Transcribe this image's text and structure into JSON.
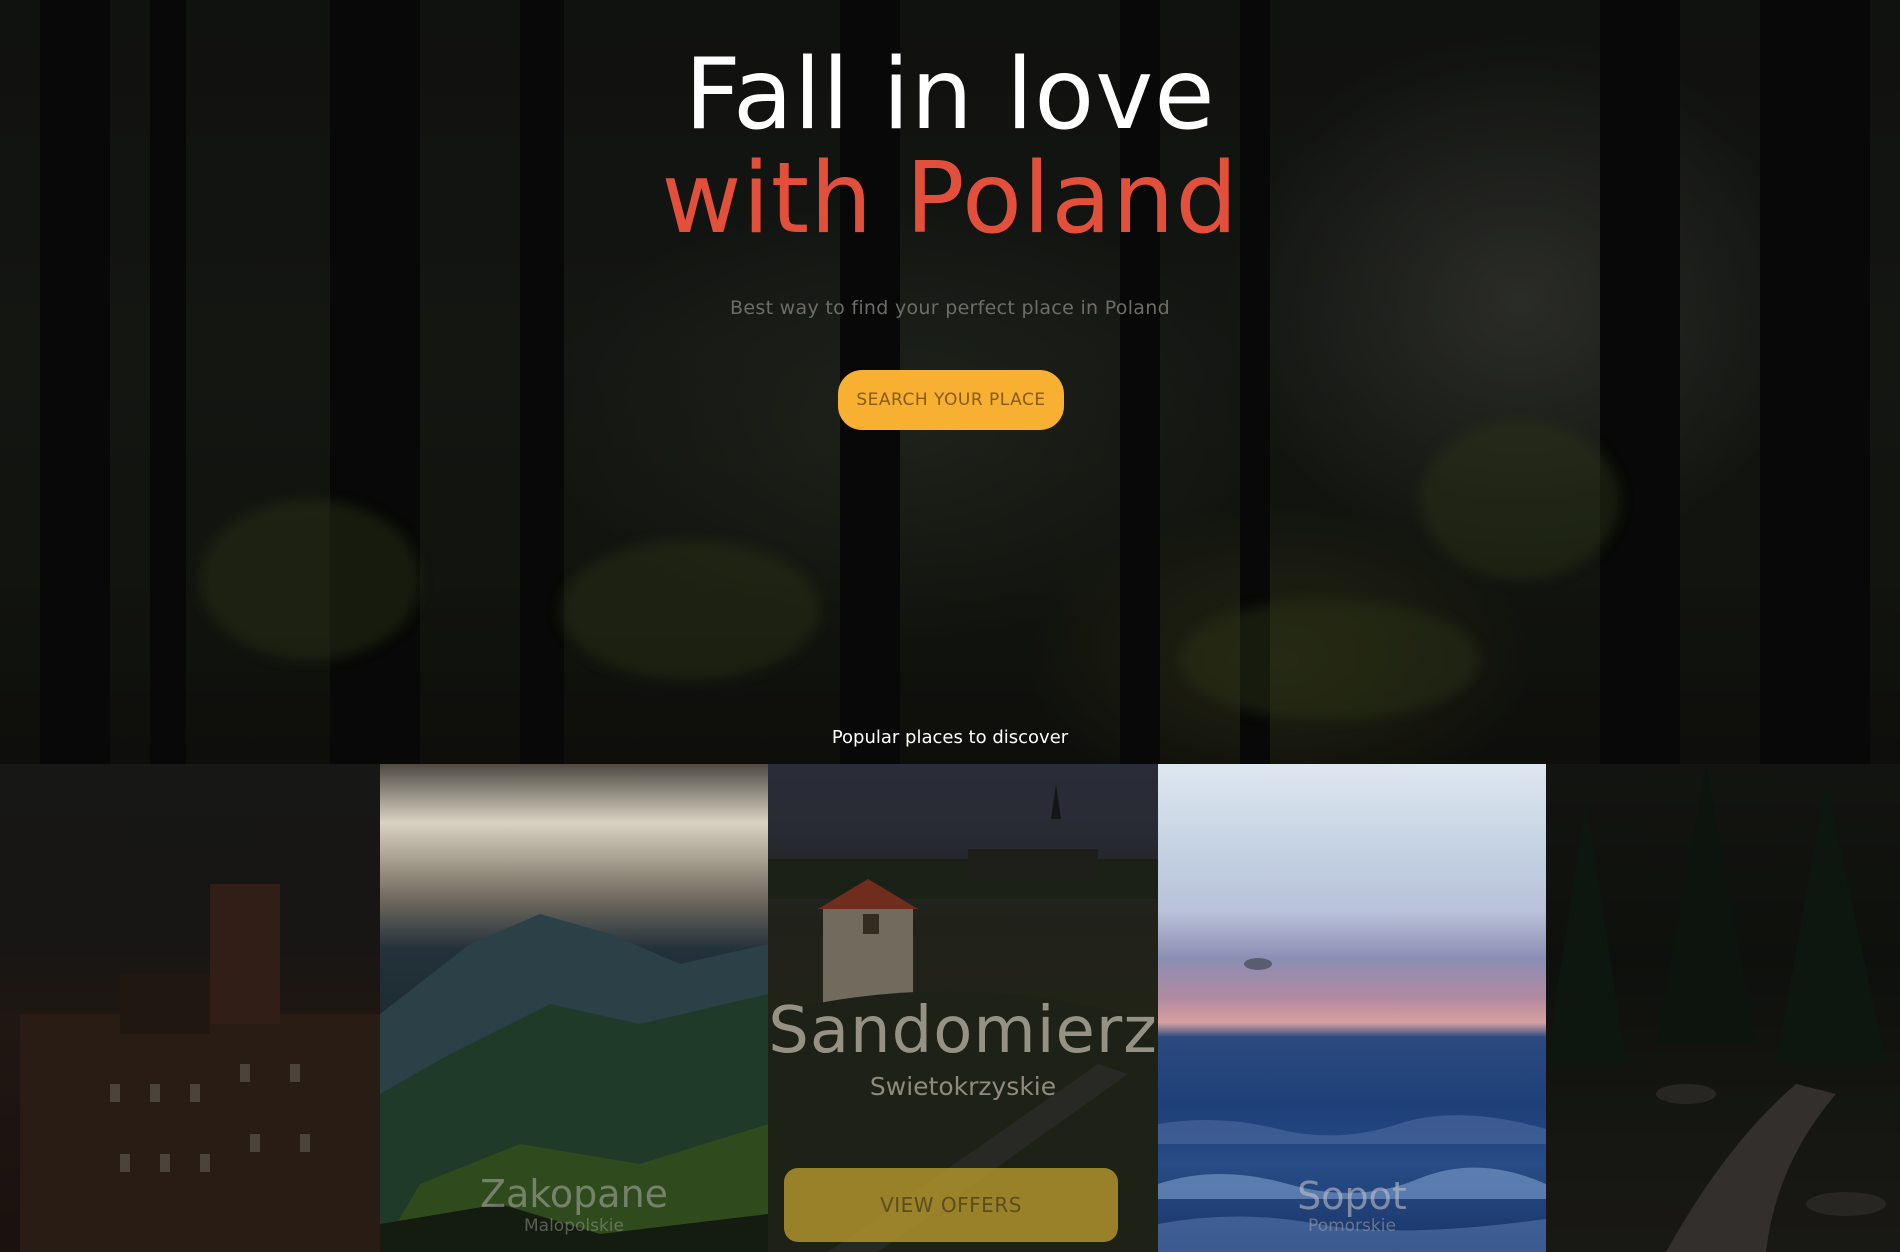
{
  "hero": {
    "title_line1": "Fall in love",
    "title_line2": "with Poland",
    "subtitle": "Best way to find your perfect place in Poland",
    "cta_label": "SEARCH YOUR PLACE",
    "section_heading": "Popular places to discover"
  },
  "places": [
    {
      "name": "Zakopane",
      "region": "Malopolskie"
    },
    {
      "name": "Sandomierz",
      "region": "Swietokrzyskie",
      "button": "VIEW OFFERS"
    },
    {
      "name": "Sopot",
      "region": "Pomorskie"
    }
  ],
  "colors": {
    "accent_red": "#e2503c",
    "cta_yellow": "#f7b031",
    "view_offers_gold": "#c7a62f"
  }
}
